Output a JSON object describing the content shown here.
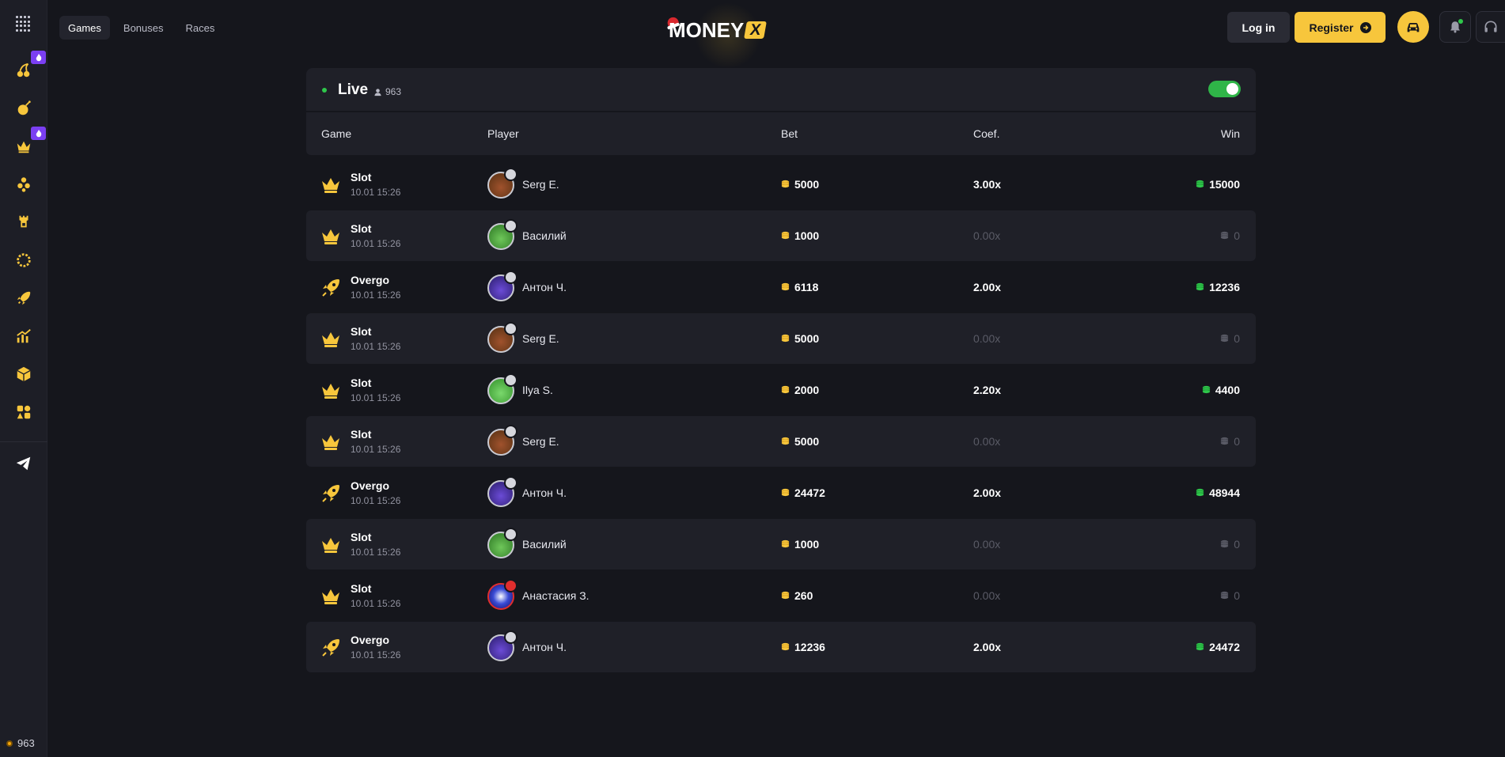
{
  "nav": {
    "tabs": [
      {
        "label": "Games"
      },
      {
        "label": "Bonuses"
      },
      {
        "label": "Races"
      }
    ]
  },
  "header": {
    "logo_text": "MONEY",
    "logo_accent": "X",
    "login_label": "Log in",
    "register_label": "Register"
  },
  "sidebar": {
    "online_count": "963"
  },
  "live": {
    "title": "Live",
    "viewers": "963",
    "toggle_on": true
  },
  "table": {
    "headers": {
      "game": "Game",
      "player": "Player",
      "bet": "Bet",
      "coef": "Coef.",
      "win": "Win"
    },
    "rows": [
      {
        "game": "Slot",
        "time": "10.01 15:26",
        "player": "Serg E.",
        "bet": "5000",
        "coef": "3.00x",
        "win": "15000"
      },
      {
        "game": "Slot",
        "time": "10.01 15:26",
        "player": "Василий",
        "bet": "1000",
        "coef": "0.00x",
        "win": "0"
      },
      {
        "game": "Overgo",
        "time": "10.01 15:26",
        "player": "Антон Ч.",
        "bet": "6118",
        "coef": "2.00x",
        "win": "12236"
      },
      {
        "game": "Slot",
        "time": "10.01 15:26",
        "player": "Serg E.",
        "bet": "5000",
        "coef": "0.00x",
        "win": "0"
      },
      {
        "game": "Slot",
        "time": "10.01 15:26",
        "player": "Ilya S.",
        "bet": "2000",
        "coef": "2.20x",
        "win": "4400"
      },
      {
        "game": "Slot",
        "time": "10.01 15:26",
        "player": "Serg E.",
        "bet": "5000",
        "coef": "0.00x",
        "win": "0"
      },
      {
        "game": "Overgo",
        "time": "10.01 15:26",
        "player": "Антон Ч.",
        "bet": "24472",
        "coef": "2.00x",
        "win": "48944"
      },
      {
        "game": "Slot",
        "time": "10.01 15:26",
        "player": "Василий",
        "bet": "1000",
        "coef": "0.00x",
        "win": "0"
      },
      {
        "game": "Slot",
        "time": "10.01 15:26",
        "player": "Анастасия З.",
        "bet": "260",
        "coef": "0.00x",
        "win": "0"
      },
      {
        "game": "Overgo",
        "time": "10.01 15:26",
        "player": "Антон Ч.",
        "bet": "12236",
        "coef": "2.00x",
        "win": "24472"
      }
    ]
  },
  "colors": {
    "accent": "#f7c63c",
    "live": "#2fc74b",
    "badge": "#7b3ff2"
  }
}
